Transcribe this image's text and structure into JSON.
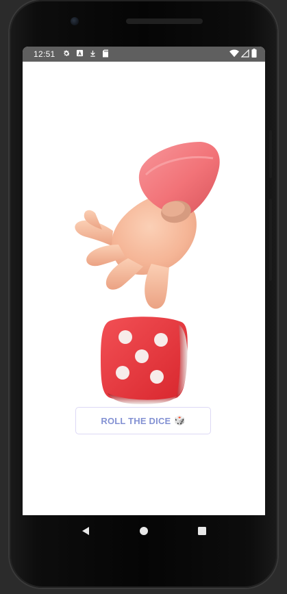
{
  "status_bar": {
    "time": "12:51",
    "left_icons": [
      "gear-icon",
      "keyboard-a-icon",
      "download-icon",
      "sd-card-icon"
    ],
    "right_icons": [
      "wifi-icon",
      "cell-signal-icon",
      "battery-icon"
    ]
  },
  "main": {
    "roll_button": {
      "label": "ROLL THE DICE",
      "emoji": "🎲"
    },
    "dice": {
      "face_value": 5,
      "color": "#e8353b"
    },
    "hand": {
      "sleeve_color": "#f27378",
      "skin_color": "#f6b79c"
    }
  },
  "nav_bar": {
    "buttons": [
      "back-icon",
      "home-icon",
      "recents-icon"
    ]
  },
  "colors": {
    "status_bar": "#5f5f5f",
    "button_text": "#8391d3",
    "button_border": "#dcd8f5",
    "screen_bg": "#ffffff",
    "device_frame": "#0a0a0a"
  }
}
